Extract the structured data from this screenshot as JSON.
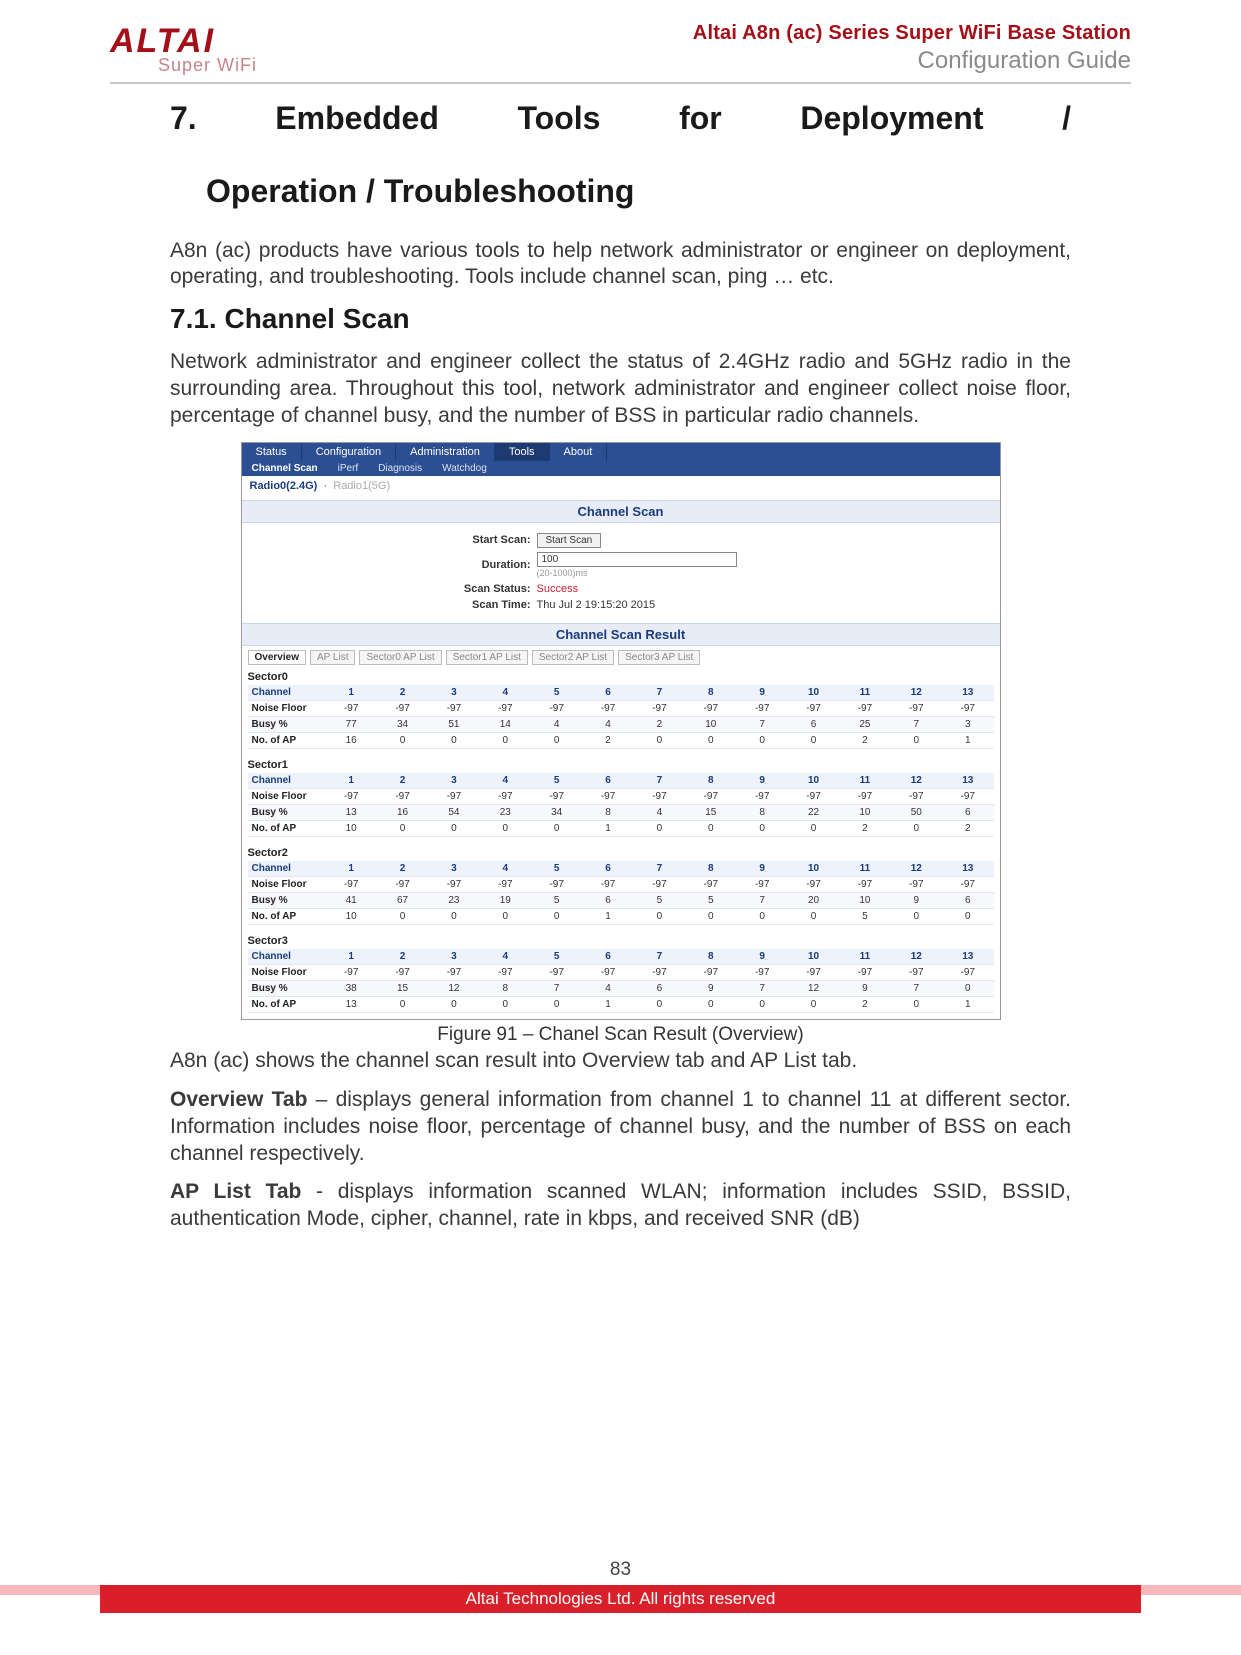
{
  "header": {
    "logo_main": "ALTAI",
    "logo_sub": "Super WiFi",
    "title_red": "Altai A8n (ac) Series Super WiFi Base Station",
    "title_grey": "Configuration Guide"
  },
  "section": {
    "h1_line1": "7. Embedded  Tools  for  Deployment  /",
    "h1_line2": "Operation / Troubleshooting",
    "intro": "A8n (ac) products have various tools to help network administrator or engineer on deployment, operating, and troubleshooting. Tools include channel scan, ping … etc.",
    "h2": "7.1. Channel Scan",
    "p2": "Network administrator and engineer collect the status of 2.4GHz radio and 5GHz radio in the surrounding area. Throughout this tool, network administrator and engineer collect noise floor, percentage of channel busy, and the number of BSS in particular radio channels.",
    "caption": "Figure 91 – Chanel Scan Result (Overview)",
    "after1": "A8n (ac) shows the channel scan result into Overview tab and AP List tab.",
    "ov_label": "Overview Tab",
    "ov_text": " – displays general information from channel 1 to channel 11 at different sector. Information includes noise floor, percentage of channel busy, and the number of BSS on each channel respectively.",
    "ap_label": "AP List Tab",
    "ap_text": " - displays information scanned WLAN; information includes SSID, BSSID, authentication Mode, cipher, channel, rate in kbps, and received SNR (dB)"
  },
  "screenshot": {
    "nav": {
      "status": "Status",
      "config": "Configuration",
      "admin": "Administration",
      "tools": "Tools",
      "about": "About"
    },
    "subnav": {
      "chscan": "Channel Scan",
      "perf": "iPerf",
      "diag": "Diagnosis",
      "watch": "Watchdog"
    },
    "radio": {
      "r0": "Radio0(2.4G)",
      "r1": "Radio1(5G)"
    },
    "panel1": "Channel Scan",
    "panel2": "Channel Scan Result",
    "form": {
      "start_lbl": "Start Scan:",
      "start_btn": "Start Scan",
      "dur_lbl": "Duration:",
      "dur_val": "100",
      "dur_hint": "(20-1000)ms",
      "status_lbl": "Scan Status:",
      "status_val": "Success",
      "time_lbl": "Scan Time:",
      "time_val": "Thu Jul 2 19:15:20 2015"
    },
    "tabs": {
      "ov": "Overview",
      "ap": "AP List",
      "s0": "Sector0 AP List",
      "s1": "Sector1 AP List",
      "s2": "Sector2 AP List",
      "s3": "Sector3 AP List"
    },
    "row_labels": {
      "ch": "Channel",
      "nf": "Noise Floor",
      "busy": "Busy %",
      "nap": "No. of AP"
    },
    "channels": [
      "1",
      "2",
      "3",
      "4",
      "5",
      "6",
      "7",
      "8",
      "9",
      "10",
      "11",
      "12",
      "13"
    ],
    "sectors": [
      {
        "name": "Sector0",
        "nf": [
          "-97",
          "-97",
          "-97",
          "-97",
          "-97",
          "-97",
          "-97",
          "-97",
          "-97",
          "-97",
          "-97",
          "-97",
          "-97"
        ],
        "busy": [
          "77",
          "34",
          "51",
          "14",
          "4",
          "4",
          "2",
          "10",
          "7",
          "6",
          "25",
          "7",
          "3"
        ],
        "nap": [
          "16",
          "0",
          "0",
          "0",
          "0",
          "2",
          "0",
          "0",
          "0",
          "0",
          "2",
          "0",
          "1"
        ]
      },
      {
        "name": "Sector1",
        "nf": [
          "-97",
          "-97",
          "-97",
          "-97",
          "-97",
          "-97",
          "-97",
          "-97",
          "-97",
          "-97",
          "-97",
          "-97",
          "-97"
        ],
        "busy": [
          "13",
          "16",
          "54",
          "23",
          "34",
          "8",
          "4",
          "15",
          "8",
          "22",
          "10",
          "50",
          "6"
        ],
        "nap": [
          "10",
          "0",
          "0",
          "0",
          "0",
          "1",
          "0",
          "0",
          "0",
          "0",
          "2",
          "0",
          "2"
        ]
      },
      {
        "name": "Sector2",
        "nf": [
          "-97",
          "-97",
          "-97",
          "-97",
          "-97",
          "-97",
          "-97",
          "-97",
          "-97",
          "-97",
          "-97",
          "-97",
          "-97"
        ],
        "busy": [
          "41",
          "67",
          "23",
          "19",
          "5",
          "6",
          "5",
          "5",
          "7",
          "20",
          "10",
          "9",
          "6"
        ],
        "nap": [
          "10",
          "0",
          "0",
          "0",
          "0",
          "1",
          "0",
          "0",
          "0",
          "0",
          "5",
          "0",
          "0"
        ]
      },
      {
        "name": "Sector3",
        "nf": [
          "-97",
          "-97",
          "-97",
          "-97",
          "-97",
          "-97",
          "-97",
          "-97",
          "-97",
          "-97",
          "-97",
          "-97",
          "-97"
        ],
        "busy": [
          "38",
          "15",
          "12",
          "8",
          "7",
          "4",
          "6",
          "9",
          "7",
          "12",
          "9",
          "7",
          "0"
        ],
        "nap": [
          "13",
          "0",
          "0",
          "0",
          "0",
          "1",
          "0",
          "0",
          "0",
          "0",
          "2",
          "0",
          "1"
        ]
      }
    ]
  },
  "footer": {
    "page": "83",
    "copyright": "Altai Technologies Ltd. All rights reserved"
  }
}
